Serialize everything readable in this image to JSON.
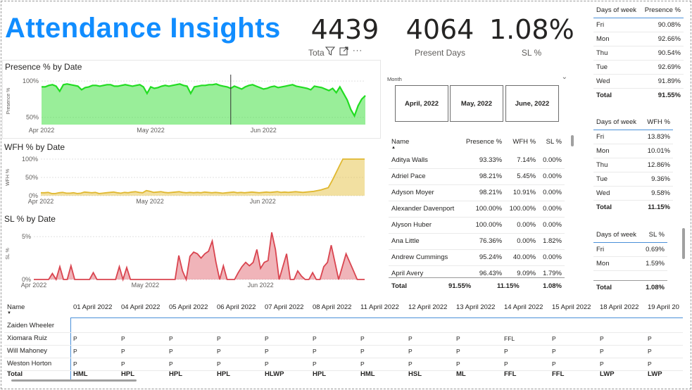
{
  "title": "Attendance Insights",
  "kpis": [
    {
      "value": "4439",
      "label": "Tota"
    },
    {
      "value": "4064",
      "label": "Present Days"
    },
    {
      "value": "1.08%",
      "label": "SL %"
    }
  ],
  "charts": {
    "presence": {
      "title": "Presence % by Date",
      "ylabel": "Presence %",
      "yticks": [
        "100%",
        "50%"
      ],
      "xticks": [
        "Apr 2022",
        "May 2022",
        "Jun 2022"
      ]
    },
    "wfh": {
      "title": "WFH % by Date",
      "ylabel": "WFH %",
      "yticks": [
        "100%",
        "50%",
        "0%"
      ],
      "xticks": [
        "Apr 2022",
        "May 2022",
        "Jun 2022"
      ]
    },
    "sl": {
      "title": "SL % by Date",
      "ylabel": "SL %",
      "yticks": [
        "5%",
        "0%"
      ],
      "xticks": [
        "Apr 2022",
        "May 2022",
        "Jun 2022"
      ]
    }
  },
  "colors": {
    "accent": "#118dff",
    "presence": "#33dd33",
    "wfh": "#e6c244",
    "sl": "#d9444f"
  },
  "chart_data": [
    {
      "type": "area",
      "title": "Presence % by Date",
      "ylabel": "Presence %",
      "ylim": [
        40,
        105
      ],
      "x_start": "2022-04-01",
      "x_end": "2022-06-30",
      "values": [
        92,
        92,
        94,
        95,
        93,
        86,
        95,
        96,
        95,
        94,
        93,
        88,
        91,
        92,
        94,
        94,
        93,
        94,
        95,
        95,
        93,
        93,
        94,
        95,
        94,
        93,
        94,
        95,
        92,
        83,
        92,
        90,
        91,
        93,
        94,
        93,
        94,
        95,
        96,
        94,
        93,
        83,
        92,
        93,
        94,
        94,
        95,
        95,
        96,
        94,
        93,
        92,
        90,
        93,
        91,
        89,
        92,
        94,
        95,
        93,
        91,
        89,
        90,
        92,
        93,
        91,
        92,
        93,
        94,
        95,
        93,
        92,
        91,
        90,
        88,
        93,
        92,
        91,
        89,
        87,
        90,
        84,
        92,
        83,
        74,
        61,
        52,
        66,
        75,
        80
      ]
    },
    {
      "type": "area",
      "title": "WFH % by Date",
      "ylabel": "WFH %",
      "ylim": [
        0,
        100
      ],
      "x_start": "2022-04-01",
      "x_end": "2022-06-30",
      "values": [
        8,
        8,
        9,
        6,
        6,
        8,
        9,
        7,
        7,
        8,
        6,
        7,
        10,
        9,
        8,
        9,
        6,
        7,
        8,
        9,
        10,
        8,
        7,
        9,
        8,
        10,
        11,
        9,
        8,
        14,
        12,
        9,
        10,
        11,
        9,
        8,
        9,
        10,
        11,
        9,
        8,
        9,
        8,
        9,
        8,
        10,
        9,
        8,
        9,
        8,
        7,
        8,
        9,
        10,
        8,
        9,
        8,
        9,
        10,
        9,
        8,
        9,
        10,
        9,
        10,
        11,
        9,
        10,
        9,
        10,
        11,
        10,
        9,
        10,
        11,
        12,
        14,
        16,
        19,
        22,
        40,
        60,
        80,
        100,
        100,
        100,
        100,
        100,
        100,
        100
      ]
    },
    {
      "type": "area",
      "title": "SL % by Date",
      "ylabel": "SL %",
      "ylim": [
        0,
        6
      ],
      "x_start": "2022-04-01",
      "x_end": "2022-06-30",
      "values": [
        0,
        0,
        0,
        0,
        0,
        0.7,
        0,
        1.5,
        0,
        0,
        1.6,
        0,
        0,
        0,
        0,
        0,
        0.8,
        0,
        0,
        0,
        0,
        0,
        0,
        1.5,
        0,
        1.4,
        0,
        0,
        0,
        0,
        0,
        0,
        0,
        0,
        0,
        0,
        0,
        0,
        0,
        2.8,
        1.0,
        0,
        2.7,
        3.2,
        3.0,
        2.5,
        3.0,
        3.3,
        4.5,
        2.0,
        0,
        1.6,
        0,
        0,
        0,
        0.8,
        1.5,
        2.0,
        1.6,
        2.0,
        3.5,
        1.3,
        2.0,
        2.2,
        5.5,
        3.5,
        0,
        1.5,
        3.0,
        0,
        0,
        1.0,
        0.4,
        0,
        0,
        0.8,
        0,
        0,
        1.5,
        2.0,
        4.0,
        2.0,
        0,
        1.5,
        3.0,
        2.0,
        1.0,
        0,
        0,
        0
      ]
    }
  ],
  "slicer": {
    "label": "Month",
    "options": [
      "April, 2022",
      "May, 2022",
      "June, 2022"
    ]
  },
  "name_table": {
    "headers": [
      "Name",
      "Presence %",
      "WFH %",
      "SL %"
    ],
    "rows": [
      [
        "Aditya Walls",
        "93.33%",
        "7.14%",
        "0.00%"
      ],
      [
        "Adriel Pace",
        "98.21%",
        "5.45%",
        "0.00%"
      ],
      [
        "Adyson Moyer",
        "98.21%",
        "10.91%",
        "0.00%"
      ],
      [
        "Alexander Davenport",
        "100.00%",
        "100.00%",
        "0.00%"
      ],
      [
        "Alyson Huber",
        "100.00%",
        "0.00%",
        "0.00%"
      ],
      [
        "Ana Little",
        "76.36%",
        "0.00%",
        "1.82%"
      ],
      [
        "Andrew Cummings",
        "95.24%",
        "40.00%",
        "0.00%"
      ],
      [
        "April Avery",
        "96.43%",
        "9.09%",
        "1.79%"
      ]
    ],
    "total": [
      "Total",
      "91.55%",
      "11.15%",
      "1.08%"
    ]
  },
  "dow_presence": {
    "headers": [
      "Days of week",
      "Presence %"
    ],
    "rows": [
      [
        "Fri",
        "90.08%"
      ],
      [
        "Mon",
        "92.66%"
      ],
      [
        "Thu",
        "90.54%"
      ],
      [
        "Tue",
        "92.69%"
      ],
      [
        "Wed",
        "91.89%"
      ]
    ],
    "total": [
      "Total",
      "91.55%"
    ]
  },
  "dow_wfh": {
    "headers": [
      "Days of week",
      "WFH %"
    ],
    "rows": [
      [
        "Fri",
        "13.83%"
      ],
      [
        "Mon",
        "10.01%"
      ],
      [
        "Thu",
        "12.86%"
      ],
      [
        "Tue",
        "9.36%"
      ],
      [
        "Wed",
        "9.58%"
      ]
    ],
    "total": [
      "Total",
      "11.15%"
    ]
  },
  "dow_sl": {
    "headers": [
      "Days of week",
      "SL %"
    ],
    "rows": [
      [
        "Fri",
        "0.69%"
      ],
      [
        "Mon",
        "1.59%"
      ]
    ],
    "total": [
      "Total",
      "1.08%"
    ]
  },
  "matrix": {
    "name_header": "Name",
    "dates": [
      "01 April 2022",
      "04 April 2022",
      "05 April 2022",
      "06 April 2022",
      "07 April 2022",
      "08 April 2022",
      "11 April 2022",
      "12 April 2022",
      "13 April 2022",
      "14 April 2022",
      "15 April 2022",
      "18 April 2022",
      "19 April 20"
    ],
    "rows": [
      {
        "name": "Zaiden Wheeler",
        "cells": [
          "",
          "",
          "",
          "",
          "",
          "",
          "",
          "",
          "",
          "",
          "",
          "",
          ""
        ]
      },
      {
        "name": "Xiomara Ruiz",
        "cells": [
          "P",
          "P",
          "P",
          "P",
          "P",
          "P",
          "P",
          "P",
          "P",
          "FFL",
          "P",
          "P",
          "P"
        ]
      },
      {
        "name": "Will Mahoney",
        "cells": [
          "P",
          "P",
          "P",
          "P",
          "P",
          "P",
          "P",
          "P",
          "P",
          "P",
          "P",
          "P",
          "P"
        ]
      },
      {
        "name": "Weston Horton",
        "cells": [
          "P",
          "P",
          "P",
          "P",
          "P",
          "P",
          "P",
          "P",
          "P",
          "P",
          "P",
          "P",
          "P"
        ]
      }
    ],
    "total": {
      "name": "Total",
      "cells": [
        "HML",
        "HPL",
        "HPL",
        "HPL",
        "HLWP",
        "HPL",
        "HML",
        "HSL",
        "ML",
        "FFL",
        "FFL",
        "LWP",
        "LWP"
      ]
    }
  }
}
